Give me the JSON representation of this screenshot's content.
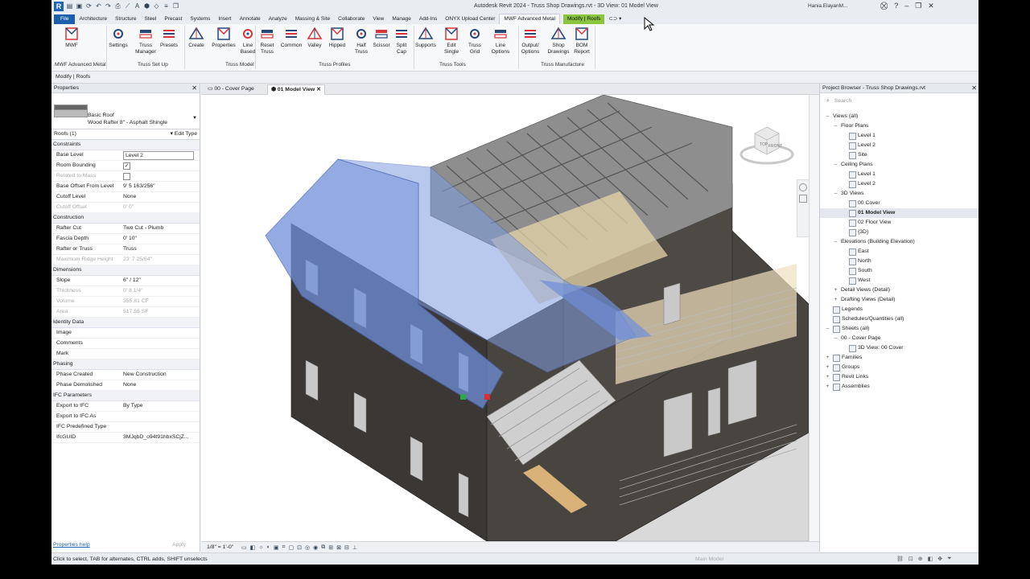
{
  "app": {
    "title": "Autodesk Revit 2024 - Truss Shop Drawings.rvt - 3D View: 01 Model View",
    "logo": "R",
    "user": "Hania.ElayanM...",
    "quick_access_icons": [
      "open-icon",
      "save-icon",
      "sync-icon",
      "undo-icon",
      "redo-icon",
      "print-icon",
      "measure-icon",
      "text-icon",
      "3d-view-icon",
      "section-icon",
      "thin-lines-icon",
      "switch-windows-icon"
    ],
    "window_controls": [
      "minimize",
      "restore",
      "close"
    ]
  },
  "tabs": [
    "File",
    "Architecture",
    "Structure",
    "Steel",
    "Precast",
    "Systems",
    "Insert",
    "Annotate",
    "Analyze",
    "Massing & Site",
    "Collaborate",
    "View",
    "Manage",
    "Add-Ins",
    "ONYX Upload Center",
    "MWF Advanced Metal",
    "Modify | Roofs"
  ],
  "active_tab": "MWF Advanced Metal",
  "ribbon": {
    "buttons": [
      {
        "id": "mwf",
        "label": "MWF",
        "icon": "mwf-logo-icon"
      },
      {
        "id": "settings",
        "label": "Settings",
        "icon": "gear-icon"
      },
      {
        "id": "truss-manager",
        "label": "Truss\nManager",
        "icon": "truss-manager-icon"
      },
      {
        "id": "presets",
        "label": "Presets",
        "icon": "presets-icon"
      },
      {
        "id": "create",
        "label": "Create",
        "icon": "create-truss-icon"
      },
      {
        "id": "properties",
        "label": "Properties",
        "icon": "properties-icon"
      },
      {
        "id": "line-based",
        "label": "Line\nBased",
        "icon": "line-based-icon"
      },
      {
        "id": "reset-truss",
        "label": "Reset\nTruss",
        "icon": "reset-icon"
      },
      {
        "id": "common",
        "label": "Common",
        "icon": "common-truss-icon"
      },
      {
        "id": "valley",
        "label": "Valley",
        "icon": "valley-truss-icon"
      },
      {
        "id": "hipped",
        "label": "Hipped",
        "icon": "hipped-truss-icon"
      },
      {
        "id": "half-truss",
        "label": "Half\nTruss",
        "icon": "half-truss-icon"
      },
      {
        "id": "scissor",
        "label": "Scissor",
        "icon": "scissor-truss-icon"
      },
      {
        "id": "split-cap",
        "label": "Split\nCap",
        "icon": "split-cap-icon"
      },
      {
        "id": "supports",
        "label": "Supports",
        "icon": "supports-icon"
      },
      {
        "id": "edit-single",
        "label": "Edit\nSingle",
        "icon": "edit-single-icon"
      },
      {
        "id": "truss-grid",
        "label": "Truss Grid",
        "icon": "truss-grid-icon"
      },
      {
        "id": "line-options",
        "label": "Line\nOptions",
        "icon": "line-options-icon"
      },
      {
        "id": "output-options",
        "label": "Output/\nOptions",
        "icon": "output-options-icon"
      },
      {
        "id": "shop-drawings",
        "label": "Shop\nDrawings",
        "icon": "printer-icon"
      },
      {
        "id": "bom-report",
        "label": "BOM\nReport",
        "icon": "bom-report-icon"
      }
    ],
    "panels": [
      "MWF Advanced Metal",
      "Truss Set Up",
      "Truss Model",
      "Truss Profiles",
      "Truss Tools",
      "Truss Manufacture"
    ]
  },
  "modify_bar": "Modify | Roofs",
  "properties": {
    "header": "Properties",
    "type_family": "Basic Roof",
    "type_name": "Wood Rafter 8\" - Asphalt Shingle",
    "instance_selector": "Roofs (1)",
    "edit_type": "Edit Type",
    "rows": [
      {
        "group": "Constraints"
      },
      {
        "k": "Base Level",
        "v": "Level 2",
        "box": true
      },
      {
        "k": "Room Bounding",
        "check": "✓"
      },
      {
        "k": "Related to Mass",
        "check": "",
        "dim": true
      },
      {
        "k": "Base Offset From Level",
        "v": "9'  5 163/256\""
      },
      {
        "k": "Cutoff Level",
        "v": "None"
      },
      {
        "k": "Cutoff Offset",
        "v": "0'  0\"",
        "dim": true
      },
      {
        "group": "Construction"
      },
      {
        "k": "Rafter Cut",
        "v": "Two Cut - Plumb"
      },
      {
        "k": "Fascia Depth",
        "v": "0'  10\""
      },
      {
        "k": "Rafter or Truss",
        "v": "Truss"
      },
      {
        "k": "Maximum Ridge Height",
        "v": "23'  7 25/64\"",
        "dim": true
      },
      {
        "group": "Dimensions"
      },
      {
        "k": "Slope",
        "v": "6\" / 12\""
      },
      {
        "k": "Thickness",
        "v": "0'  8 1/4\"",
        "dim": true
      },
      {
        "k": "Volume",
        "v": "355.81 CF",
        "dim": true
      },
      {
        "k": "Area",
        "v": "517.55 SF",
        "dim": true
      },
      {
        "group": "Identity Data"
      },
      {
        "k": "Image",
        "v": ""
      },
      {
        "k": "Comments",
        "v": ""
      },
      {
        "k": "Mark",
        "v": ""
      },
      {
        "group": "Phasing"
      },
      {
        "k": "Phase Created",
        "v": "New Construction"
      },
      {
        "k": "Phase Demolished",
        "v": "None"
      },
      {
        "group": "IFC Parameters"
      },
      {
        "k": "Export to IFC",
        "v": "By Type"
      },
      {
        "k": "Export to IFC As",
        "v": ""
      },
      {
        "k": "IFC Predefined Type",
        "v": ""
      },
      {
        "k": "IfcGUID",
        "v": "3MJqbD_o94t91hbxSCjZ..."
      }
    ],
    "help_link": "Properties help",
    "apply": "Apply"
  },
  "view_tabs": [
    {
      "label": "00 - Cover Page",
      "active": false
    },
    {
      "label": "01 Model View",
      "active": true
    }
  ],
  "view_control": {
    "scale": "1/8\" = 1'-0\""
  },
  "view_cube": {
    "top": "TOP",
    "front": "FRONT"
  },
  "browser": {
    "header": "Project Browser - Truss Shop Drawings.rvt",
    "search_placeholder": "Search",
    "tree": [
      {
        "d": 0,
        "exp": "–",
        "label": "Views (all)"
      },
      {
        "d": 1,
        "exp": "–",
        "label": "Floor Plans"
      },
      {
        "d": 2,
        "icon": true,
        "label": "Level 1"
      },
      {
        "d": 2,
        "icon": true,
        "label": "Level 2"
      },
      {
        "d": 2,
        "icon": true,
        "label": "Site"
      },
      {
        "d": 1,
        "exp": "–",
        "label": "Ceiling Plans"
      },
      {
        "d": 2,
        "icon": true,
        "label": "Level 1"
      },
      {
        "d": 2,
        "icon": true,
        "label": "Level 2"
      },
      {
        "d": 1,
        "exp": "–",
        "label": "3D Views"
      },
      {
        "d": 2,
        "icon": true,
        "label": "00 Cover"
      },
      {
        "d": 2,
        "icon": true,
        "label": "01 Model View",
        "sel": true
      },
      {
        "d": 2,
        "icon": true,
        "label": "02 Floor View"
      },
      {
        "d": 2,
        "icon": true,
        "label": "{3D}"
      },
      {
        "d": 1,
        "exp": "–",
        "label": "Elevations (Building Elevation)"
      },
      {
        "d": 2,
        "icon": true,
        "label": "East"
      },
      {
        "d": 2,
        "icon": true,
        "label": "North"
      },
      {
        "d": 2,
        "icon": true,
        "label": "South"
      },
      {
        "d": 2,
        "icon": true,
        "label": "West"
      },
      {
        "d": 1,
        "exp": "+",
        "label": "Detail Views (Detail)"
      },
      {
        "d": 1,
        "exp": "+",
        "label": "Drafting Views (Detail)"
      },
      {
        "d": 0,
        "exp": "",
        "icon": true,
        "label": "Legends"
      },
      {
        "d": 0,
        "exp": "",
        "icon": true,
        "label": "Schedules/Quantities (all)"
      },
      {
        "d": 0,
        "exp": "–",
        "icon": true,
        "label": "Sheets (all)"
      },
      {
        "d": 1,
        "exp": "–",
        "label": "00 - Cover Page"
      },
      {
        "d": 2,
        "icon": true,
        "label": "3D View: 00 Cover"
      },
      {
        "d": 0,
        "exp": "+",
        "icon": true,
        "label": "Families"
      },
      {
        "d": 0,
        "exp": "+",
        "icon": true,
        "label": "Groups"
      },
      {
        "d": 0,
        "exp": "+",
        "icon": true,
        "label": "Revit Links"
      },
      {
        "d": 0,
        "exp": "+",
        "icon": true,
        "label": "Assemblies"
      }
    ]
  },
  "status": {
    "message": "Click to select, TAB for alternates, CTRL adds, SHIFT unselects",
    "main_model": "Main Model"
  },
  "colors": {
    "accent": "#1e5fad",
    "context_tab": "#8bc53f",
    "ribbon_red": "#d8343a",
    "ribbon_blue": "#26477a",
    "roof_blue": "#6f8fd9"
  }
}
